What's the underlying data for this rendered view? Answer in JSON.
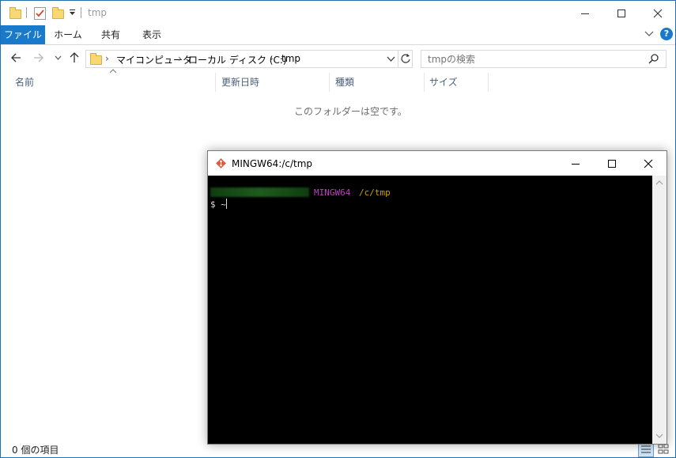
{
  "window": {
    "title": "tmp",
    "caption_buttons": [
      "minimize-icon",
      "maximize-icon",
      "close-icon"
    ]
  },
  "ribbon": {
    "tabs": [
      {
        "label": "ファイル",
        "active": true
      },
      {
        "label": "ホーム",
        "active": false
      },
      {
        "label": "共有",
        "active": false
      },
      {
        "label": "表示",
        "active": false
      }
    ],
    "help_icon": "help-icon"
  },
  "navigation": {
    "breadcrumb": [
      "マイコンピュータ",
      "ローカル ディスク (C:)",
      "tmp"
    ],
    "search_placeholder": "tmpの検索"
  },
  "columns": [
    "名前",
    "更新日時",
    "種類",
    "サイズ"
  ],
  "empty_message": "このフォルダーは空です。",
  "status_bar": {
    "item_count": "0 個の項目"
  },
  "terminal": {
    "title": "MINGW64:/c/tmp",
    "prompt_host": "MINGW64",
    "prompt_path": "/c/tmp",
    "input_line": "$ ~",
    "colors": {
      "user_host": "#1e7f1e",
      "mingw": "#bf40bf",
      "path": "#c8a000",
      "background": "#000000"
    }
  },
  "colors": {
    "accent": "#1979ca",
    "window_border": "#1f6fb2"
  }
}
